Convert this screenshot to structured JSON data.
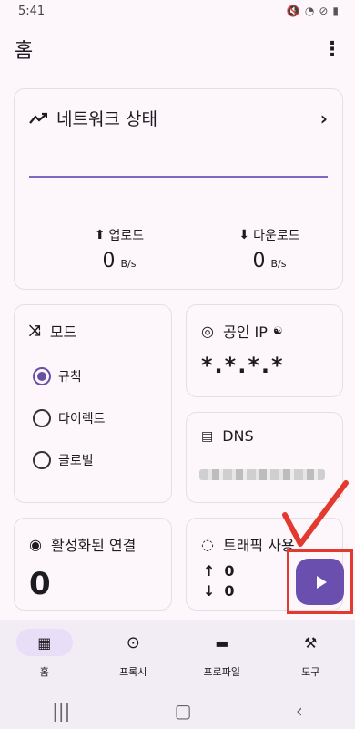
{
  "status": {
    "time": "5:41"
  },
  "app": {
    "title": "홈"
  },
  "network": {
    "title": "네트워크 상태",
    "upload_label": "업로드",
    "upload_value": "0",
    "upload_unit": "B/s",
    "download_label": "다운로드",
    "download_value": "0",
    "download_unit": "B/s"
  },
  "mode": {
    "title": "모드",
    "options": [
      "규칙",
      "다이렉트",
      "글로벌"
    ],
    "selected": "규칙"
  },
  "public_ip": {
    "title": "공인 IP",
    "value": "*.*.*.*"
  },
  "dns": {
    "title": "DNS"
  },
  "connections": {
    "title": "활성화된 연결",
    "value": "0"
  },
  "traffic": {
    "title": "트래픽 사용",
    "up": "0",
    "down": "0"
  },
  "nav": {
    "items": [
      "홈",
      "프록시",
      "프로파일",
      "도구"
    ],
    "active": "홈"
  },
  "colors": {
    "accent": "#6750a4",
    "fab": "#6a4fae",
    "annotation": "#e33a2f"
  }
}
